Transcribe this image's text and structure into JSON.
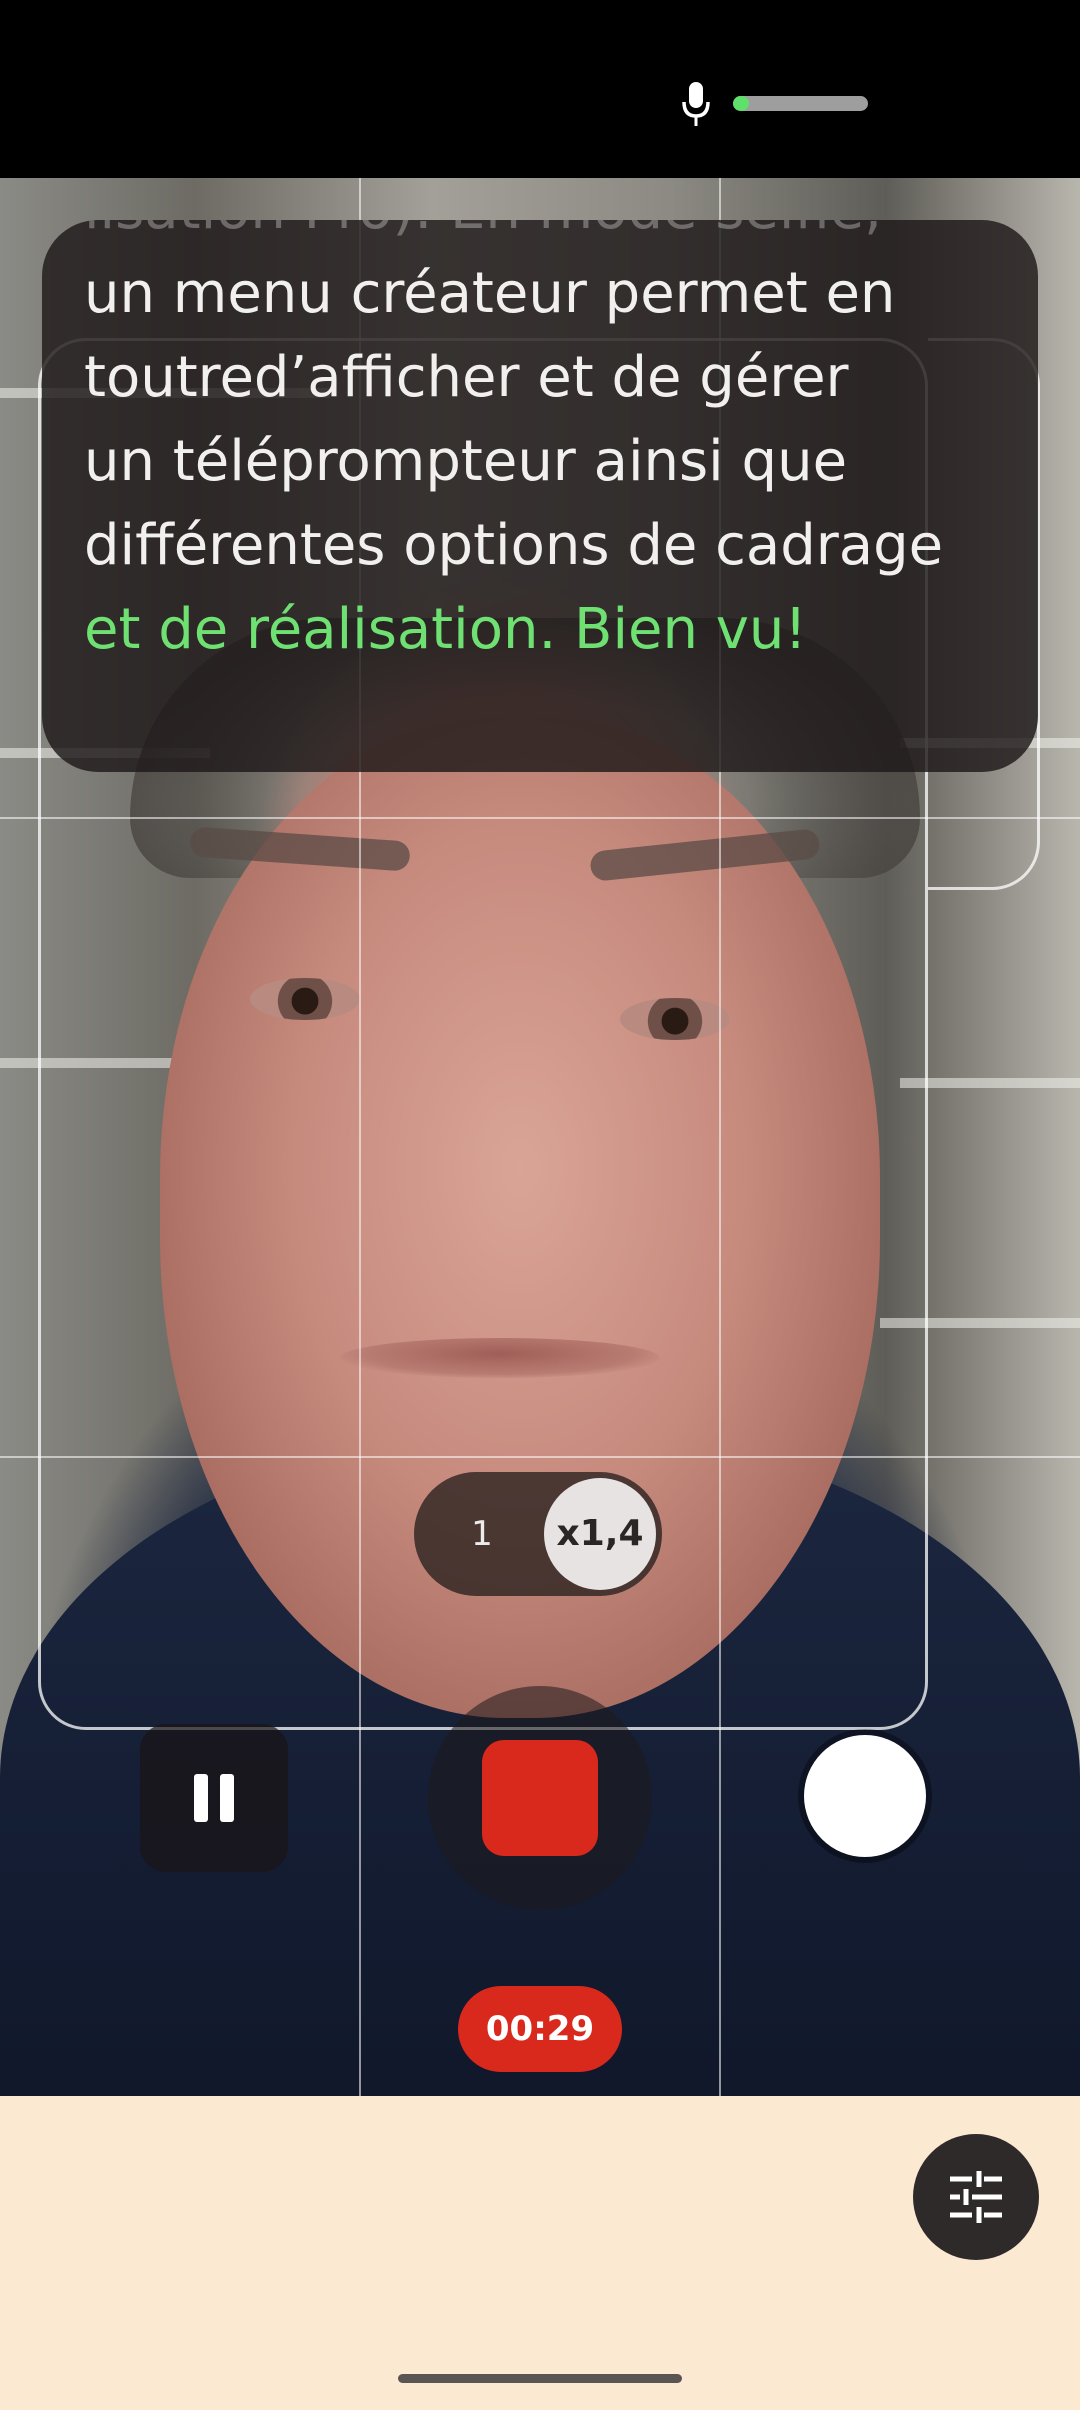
{
  "status": {
    "mic_icon": "mic-icon",
    "audio_level": 0.12,
    "colors": {
      "meter_fill": "#5ee06a",
      "meter_track": "#9e9e9e"
    }
  },
  "teleprompter": {
    "lines": [
      {
        "text": "lisation Pro). En mode selfie,",
        "state": "scrolled"
      },
      {
        "text": "un menu créateur permet en",
        "state": "upcoming"
      },
      {
        "text": "toutred’afficher et de gérer",
        "state": "upcoming"
      },
      {
        "text": "un téléprompteur ainsi que",
        "state": "upcoming"
      },
      {
        "text": "différentes options de cadrage",
        "state": "upcoming"
      },
      {
        "text": "et de réalisation. Bien vu!",
        "state": "spoken"
      }
    ],
    "colors": {
      "text": "#f2f0ee",
      "spoken": "#6fe072"
    }
  },
  "zoom": {
    "options": [
      "1",
      "x1,4"
    ],
    "selected": "x1,4"
  },
  "controls": {
    "pause_icon": "pause-icon",
    "stop_icon": "stop-icon",
    "snapshot_icon": "shutter-icon",
    "timer": "00:29",
    "colors": {
      "record": "#d9291c"
    }
  },
  "settings": {
    "icon": "sliders-icon"
  },
  "colors": {
    "bottom_panel": "#fbe9d2",
    "top_bar": "#000000"
  }
}
